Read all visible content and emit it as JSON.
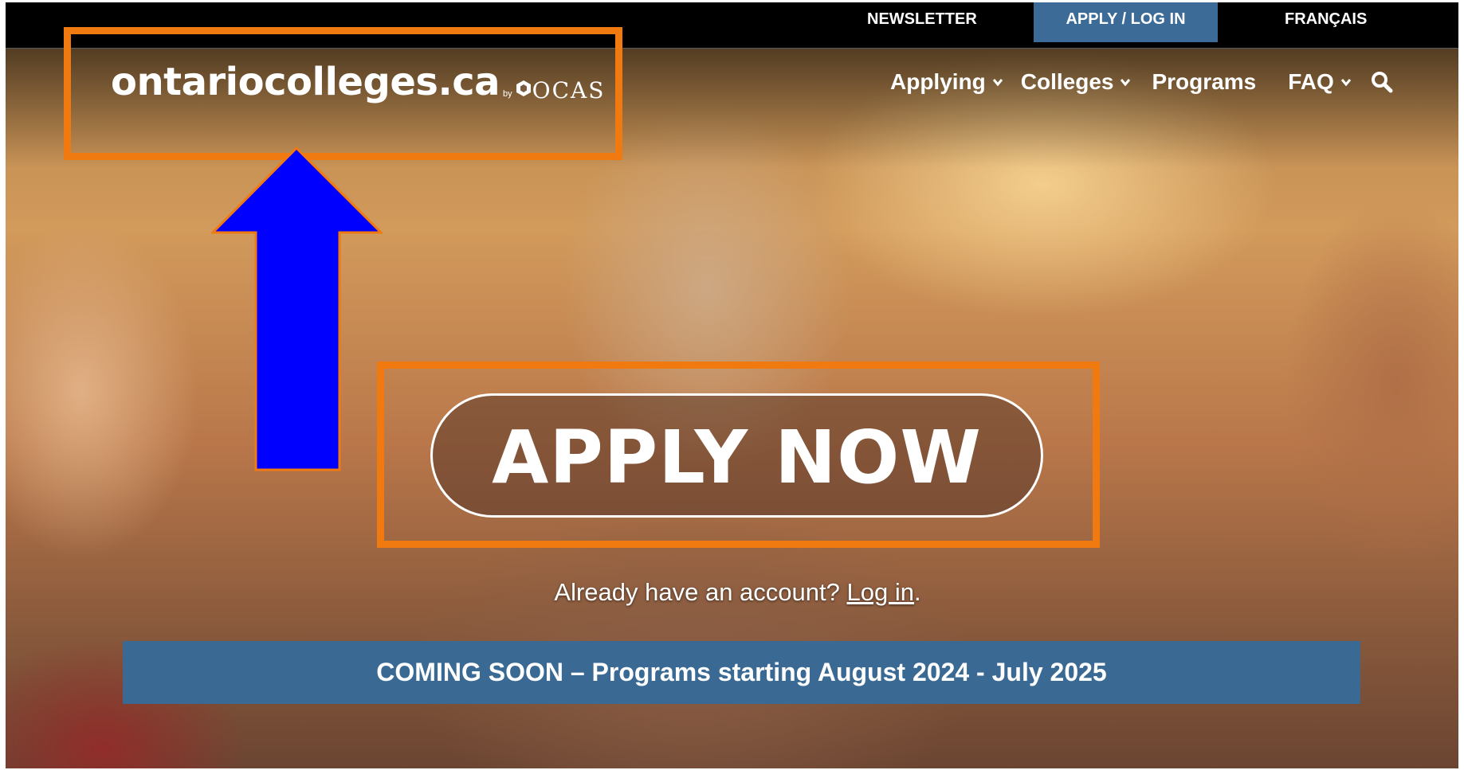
{
  "topbar": {
    "newsletter": "NEWSLETTER",
    "apply_login": "APPLY / LOG IN",
    "francais": "FRANÇAIS"
  },
  "logo": {
    "main": "ontariocolleges.ca",
    "by": "by",
    "ocas": "OCAS"
  },
  "nav": {
    "items": [
      {
        "label": "Applying",
        "dropdown": true
      },
      {
        "label": "Colleges",
        "dropdown": true
      },
      {
        "label": "Programs",
        "dropdown": false
      },
      {
        "label": "FAQ",
        "dropdown": true
      }
    ],
    "search_icon": "search-icon"
  },
  "hero": {
    "apply_button": "APPLY NOW",
    "already_text": "Already have an account?",
    "login_link": "Log in",
    "period": "."
  },
  "banner": {
    "text": "COMING SOON – Programs starting August 2024 - July 2025"
  },
  "colors": {
    "topbar_bg": "#000000",
    "accent_blue": "#3b6b96",
    "annotation_orange": "#f07a10",
    "annotation_arrow": "#0000ff"
  }
}
